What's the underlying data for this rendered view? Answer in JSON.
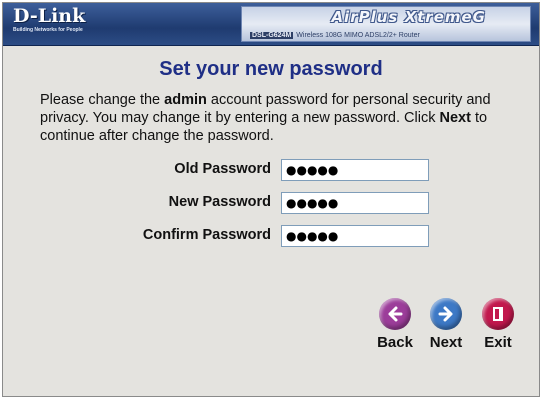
{
  "brand": {
    "name": "D-Link",
    "tagline": "Building Networks for People"
  },
  "product": {
    "logo_text": "AirPlus XtremeG",
    "model": "DSL-G624M",
    "description": "Wireless 108G MIMO ADSL2/2+ Router"
  },
  "page": {
    "title": "Set your new password",
    "intro_part1": "Please change the ",
    "intro_bold1": "admin",
    "intro_part2": " account password for personal security and privacy. You may change it by entering a new password. Click ",
    "intro_bold2": "Next",
    "intro_part3": " to continue after change the password."
  },
  "form": {
    "old_password_label": "Old Password",
    "old_password_value": "●●●●●",
    "new_password_label": "New Password",
    "new_password_value": "●●●●●",
    "confirm_password_label": "Confirm Password",
    "confirm_password_value": "●●●●●"
  },
  "nav": {
    "back_label": "Back",
    "next_label": "Next",
    "exit_label": "Exit"
  },
  "icons": {
    "back": "arrow-left-icon",
    "next": "arrow-right-icon",
    "exit": "door-icon"
  },
  "colors": {
    "title": "#1f2f86",
    "header": "#1f3b70",
    "back_button": "#9c3d9a",
    "next_button": "#3d79c6",
    "exit_button": "#c2184d"
  }
}
